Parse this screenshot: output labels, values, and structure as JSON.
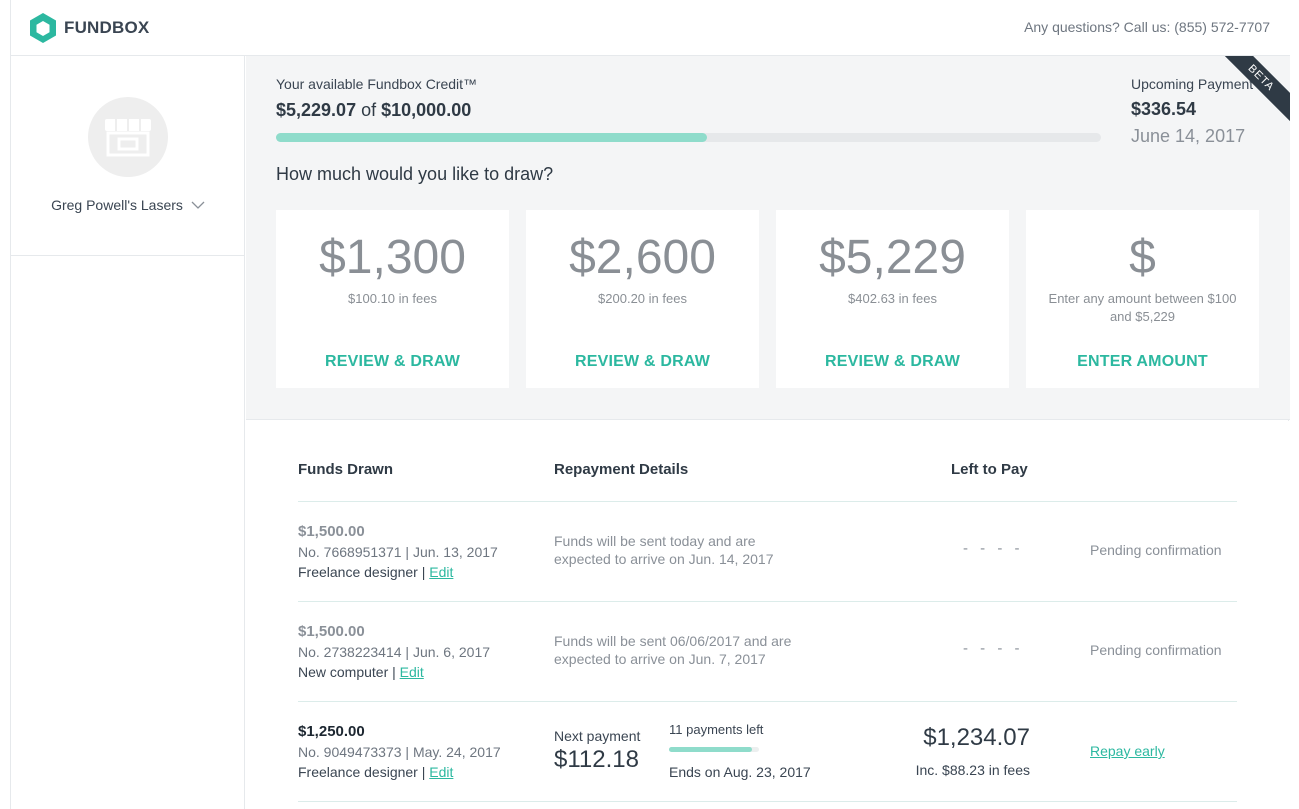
{
  "header": {
    "brand": "FUNDBOX",
    "help_text": "Any questions? Call us: (855) 572-7707",
    "brand_color": "#2cb8a0"
  },
  "sidebar": {
    "business_name": "Greg Powell's Lasers",
    "avatar_icon": "storefront-icon",
    "switch_icon": "chevron-down-icon"
  },
  "credit": {
    "label": "Your available Fundbox Credit™",
    "available": "$5,229.07",
    "of_text": "of",
    "limit": "$10,000.00",
    "used_fraction": 0.5229,
    "draw_question": "How much would you like to draw?",
    "beta_label": "BETA"
  },
  "upcoming": {
    "label": "Upcoming Payment",
    "amount": "$336.54",
    "date": "June 14, 2017"
  },
  "draw_options": [
    {
      "amount": "$1,300",
      "fees": "$100.10 in fees",
      "action": "REVIEW & DRAW"
    },
    {
      "amount": "$2,600",
      "fees": "$200.20 in fees",
      "action": "REVIEW & DRAW"
    },
    {
      "amount": "$5,229",
      "fees": "$402.63 in fees",
      "action": "REVIEW & DRAW"
    },
    {
      "amount": "$",
      "fees": "Enter any amount between $100 and $5,229",
      "action": "ENTER AMOUNT"
    }
  ],
  "table": {
    "headers": {
      "funds_drawn": "Funds Drawn",
      "repayment_details": "Repayment Details",
      "left_to_pay": "Left to Pay"
    },
    "rows": [
      {
        "amount": "$1,500.00",
        "number_date": "No. 7668951371 | Jun. 13, 2017",
        "purpose": "Freelance designer | ",
        "edit": "Edit",
        "note": "Funds will be sent today and are expected to arrive on Jun. 14, 2017",
        "left": "- - - -",
        "status": "Pending confirmation"
      },
      {
        "amount": "$1,500.00",
        "number_date": "No. 2738223414 | Jun. 6, 2017",
        "purpose": "New computer | ",
        "edit": "Edit",
        "note": "Funds will be sent 06/06/2017 and are expected to arrive on Jun. 7, 2017",
        "left": "- - - -",
        "status": "Pending confirmation"
      },
      {
        "amount": "$1,250.00",
        "number_date": "No. 9049473373 | May. 24, 2017",
        "purpose": "Freelance designer | ",
        "edit": "Edit",
        "next_payment_label": "Next payment",
        "next_payment_amount": "$112.18",
        "payments_left": "11 payments left",
        "payments_progress_fraction": 0.92,
        "ends_on": "Ends on Aug. 23, 2017",
        "left_amount": "$1,234.07",
        "left_fees": "Inc. $88.23 in fees",
        "action": "Repay early"
      }
    ]
  }
}
